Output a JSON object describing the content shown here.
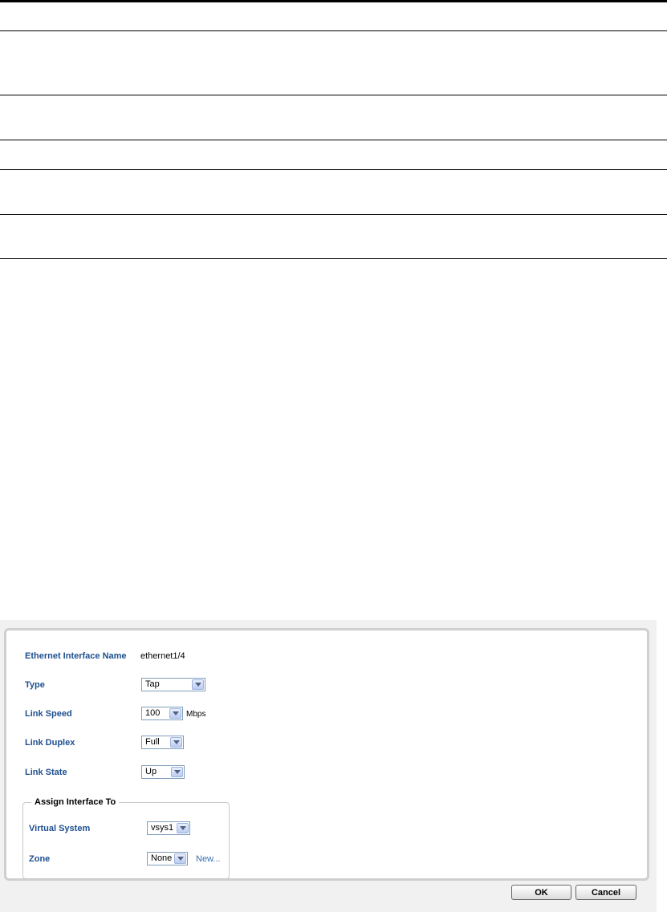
{
  "dialog": {
    "fields": {
      "interface_name_label": "Ethernet Interface Name",
      "interface_name_value": "ethernet1/4",
      "type_label": "Type",
      "type_value": "Tap",
      "link_speed_label": "Link Speed",
      "link_speed_value": "100",
      "link_speed_unit": "Mbps",
      "link_duplex_label": "Link Duplex",
      "link_duplex_value": "Full",
      "link_state_label": "Link State",
      "link_state_value": "Up"
    },
    "assign": {
      "legend": "Assign Interface To",
      "virtual_system_label": "Virtual System",
      "virtual_system_value": "vsys1",
      "zone_label": "Zone",
      "zone_value": "None",
      "new_link": "New..."
    },
    "buttons": {
      "ok": "OK",
      "cancel": "Cancel"
    }
  }
}
